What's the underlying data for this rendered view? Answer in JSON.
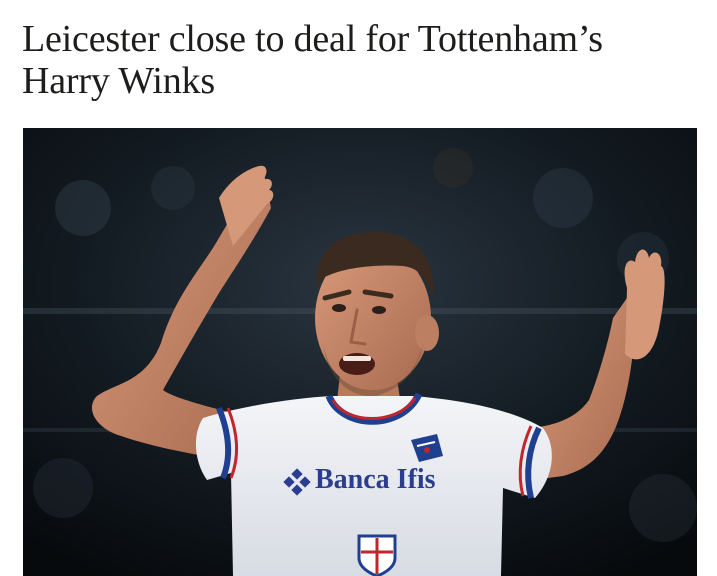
{
  "article": {
    "headline_line1": "Leicester close to deal for Tottenham’s",
    "headline_line2": "Harry Winks"
  },
  "hero_image": {
    "alt": "Harry Winks gesturing with both arms raised, wearing a white Sampdoria shirt",
    "sponsor_text": "Banca Ifis",
    "colors": {
      "shirt": "#eef0f5",
      "collar_blue": "#1f3f8f",
      "collar_red": "#c0272d",
      "skin": "#c9896a",
      "hair": "#3a2a20",
      "background": "#0d1217"
    }
  }
}
